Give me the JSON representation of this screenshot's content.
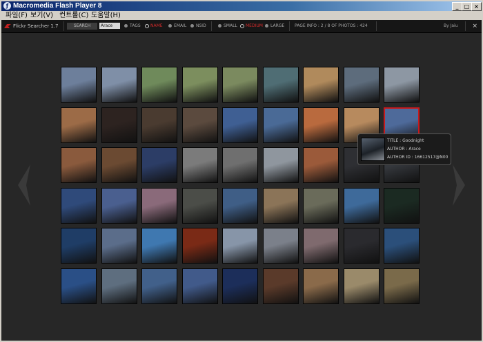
{
  "window": {
    "title": "Macromedia Flash Player 8",
    "controls": {
      "minimize": "_",
      "maximize": "□",
      "close": "×"
    }
  },
  "menu": {
    "items": [
      "파일(F)",
      "보기(V)",
      "컨트롤(C)",
      "도움말(H)"
    ]
  },
  "app": {
    "title": "Flickr Searcher 1.7",
    "search_button": "SEARCH",
    "search_value": "Arace",
    "type_options": [
      {
        "label": "TAGS",
        "active": false
      },
      {
        "label": "NAME",
        "active": true
      },
      {
        "label": "EMAIL",
        "active": false
      },
      {
        "label": "NSID",
        "active": false
      }
    ],
    "size_options": [
      {
        "label": "SMALL",
        "active": false
      },
      {
        "label": "MEDIUM",
        "active": true
      },
      {
        "label": "LARGE",
        "active": false
      }
    ],
    "page_info": "PAGE INFO : 2 / 8 OF PHOTOS : 424",
    "credit": "By Jaiu",
    "close": "×"
  },
  "gallery": {
    "rows": [
      [
        "#6d7f9b",
        "#7f8fa7",
        "#6f8a5b",
        "#7c8e5e",
        "#7b8a5f",
        "#4f6d74",
        "#b08a5c",
        "#5d6c7c",
        "#8d97a3"
      ],
      [
        "#9c6b47",
        "#2d2320",
        "#4a3b30",
        "#5b4a3e",
        "#3f5f93",
        "#4a6a96",
        "#b96a3e",
        "#b78a5e",
        "#4e6a9a"
      ],
      [
        "#8a5a3d",
        "#6b4a32",
        "#2c3d66",
        "#7b7b7b",
        "#6f6f6f",
        "#8f969e",
        "#9b5a3a",
        "#2e2f33",
        "#35383d"
      ],
      [
        "#2f4a7a",
        "#4a5f8f",
        "#8a6a7a",
        "#4b4d48",
        "#3f5e86",
        "#8b7458",
        "#6a6b5a",
        "#3e6a9a",
        "#1b2a22"
      ],
      [
        "#1f3d66",
        "#5b6d8a",
        "#3f78b0",
        "#7a2a16",
        "#8795a8",
        "#7b808a",
        "#7f6a6e",
        "#2a2a2e",
        "#2b4f7a"
      ],
      [
        "#2a4f86",
        "#5e6e7f",
        "#41608a",
        "#415a8a",
        "#1c2e5a",
        "#5a3a2a",
        "#8a6a4a",
        "#9a8a6a",
        "#7a6a4a"
      ]
    ],
    "selected": {
      "row": 1,
      "col": 8
    }
  },
  "tooltip": {
    "title": "TITLE : Goodnight",
    "author": "AUTHOR : Arace",
    "author_id": "AUTHOR ID : 16612517@N00"
  }
}
